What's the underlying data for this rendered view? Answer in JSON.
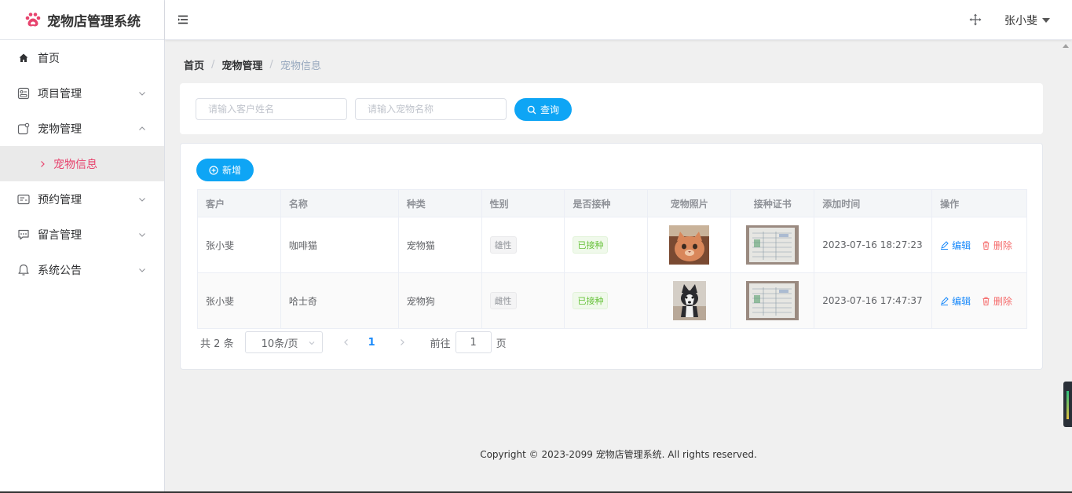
{
  "app": {
    "title": "宠物店管理系统",
    "brand_color": "#e7446e",
    "primary_color": "#0ea5f5"
  },
  "sidebar": {
    "items": [
      {
        "label": "首页",
        "icon": "home-icon"
      },
      {
        "label": "项目管理",
        "icon": "project-icon"
      },
      {
        "label": "宠物管理",
        "icon": "pet-icon",
        "expanded": true
      },
      {
        "label": "宠物信息",
        "icon": "chevron-right-icon",
        "active": true
      },
      {
        "label": "预约管理",
        "icon": "appointment-icon"
      },
      {
        "label": "留言管理",
        "icon": "message-icon"
      },
      {
        "label": "系统公告",
        "icon": "bell-icon"
      }
    ]
  },
  "header": {
    "user_name": "张小斐"
  },
  "breadcrumb": {
    "home": "首页",
    "parent": "宠物管理",
    "current": "宠物信息",
    "separator": "/"
  },
  "search": {
    "customer_placeholder": "请输入客户姓名",
    "pet_placeholder": "请输入宠物名称",
    "query_label": "查询"
  },
  "toolbar": {
    "add_label": "新增"
  },
  "table": {
    "columns": [
      "客户",
      "名称",
      "种类",
      "性别",
      "是否接种",
      "宠物照片",
      "接种证书",
      "添加时间",
      "操作"
    ],
    "rows": [
      {
        "customer": "张小斐",
        "name": "咖啡猫",
        "type": "宠物猫",
        "gender": "雄性",
        "vaccinated": "已接种",
        "added": "2023-07-16 18:27:23"
      },
      {
        "customer": "张小斐",
        "name": "哈士奇",
        "type": "宠物狗",
        "gender": "雌性",
        "vaccinated": "已接种",
        "added": "2023-07-16 17:47:37"
      }
    ],
    "edit_label": "编辑",
    "delete_label": "删除"
  },
  "pagination": {
    "total_prefix": "共",
    "total": "2",
    "total_suffix": "条",
    "page_size": "10条/页",
    "current_page": "1",
    "goto_label": "前往",
    "goto_value": "1",
    "goto_suffix": "页"
  },
  "footer": {
    "copyright": "Copyright © 2023-2099 宠物店管理系统. All rights reserved."
  }
}
